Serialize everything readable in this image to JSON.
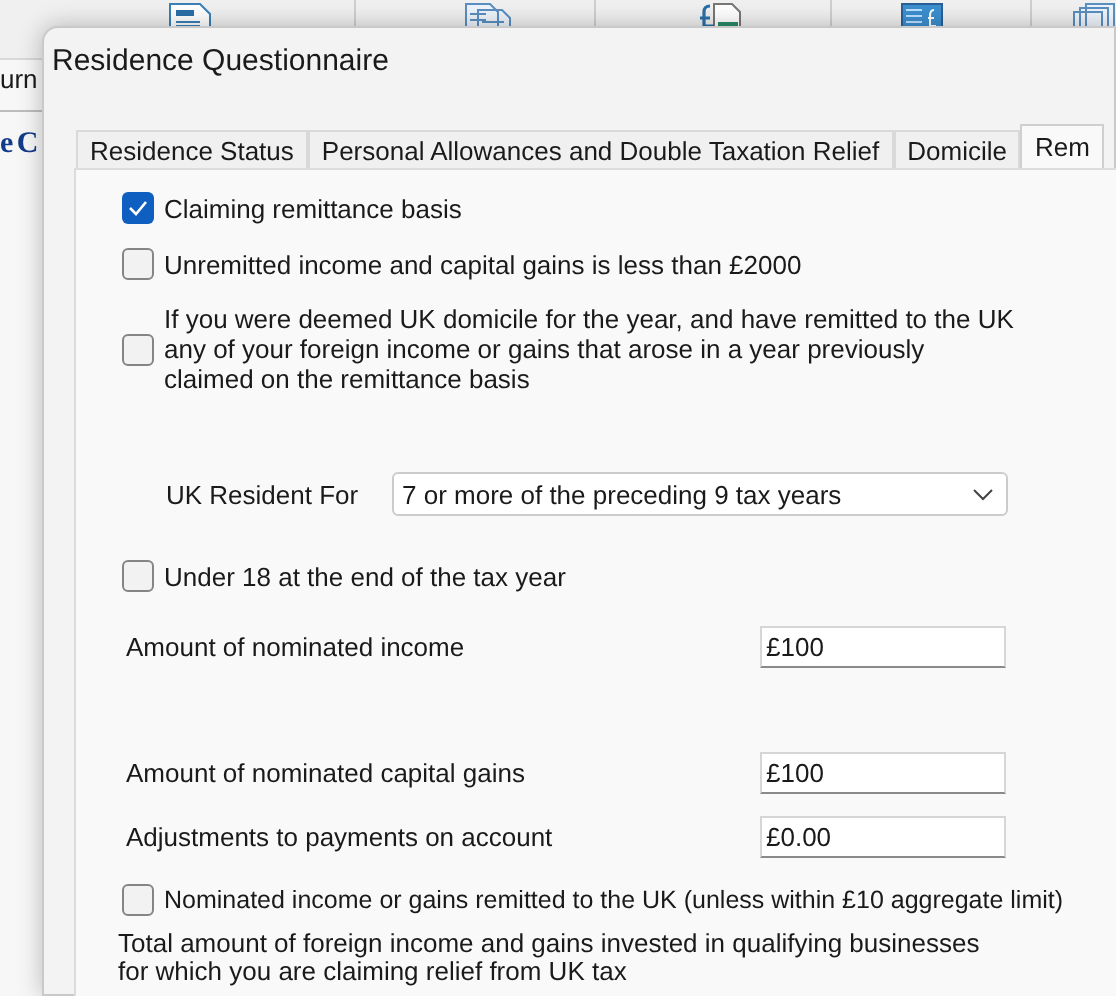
{
  "background": {
    "menu_fragment": "urn",
    "heading_fragment": "e C"
  },
  "dialog": {
    "title": "Residence Questionnaire",
    "tabs": [
      {
        "label": "Residence Status",
        "selected": false
      },
      {
        "label": "Personal Allowances and Double Taxation Relief",
        "selected": false
      },
      {
        "label": "Domicile",
        "selected": false
      },
      {
        "label": "Rem",
        "selected": true
      }
    ]
  },
  "form": [
    {
      "kind": "checkbox",
      "label": "Claiming remittance basis",
      "checked": true
    },
    {
      "kind": "checkbox",
      "label": "Unremitted income and capital gains is less than £2000",
      "checked": false
    },
    {
      "kind": "checkbox",
      "label": "If you were deemed UK domicile for the year, and have remitted to the UK any of your foreign income or gains that arose in a year previously claimed on the remittance basis",
      "checked": false
    },
    {
      "kind": "select",
      "label": "UK Resident For",
      "value": "7 or more of the preceding 9 tax years"
    },
    {
      "kind": "checkbox",
      "label": "Under 18 at the end of the tax year",
      "checked": false
    },
    {
      "kind": "amount",
      "label": "Amount of nominated income",
      "value": "£100"
    },
    {
      "kind": "amount",
      "label": "Amount of nominated capital gains",
      "value": "£100"
    },
    {
      "kind": "amount",
      "label": "Adjustments to payments on account",
      "value": "£0.00"
    },
    {
      "kind": "checkbox",
      "label": "Nominated income or gains remitted to the UK (unless within £10 aggregate limit)",
      "checked": false
    },
    {
      "kind": "note",
      "label": "Total amount of foreign income and gains invested in qualifying businesses for which you are claiming relief from UK tax"
    }
  ]
}
